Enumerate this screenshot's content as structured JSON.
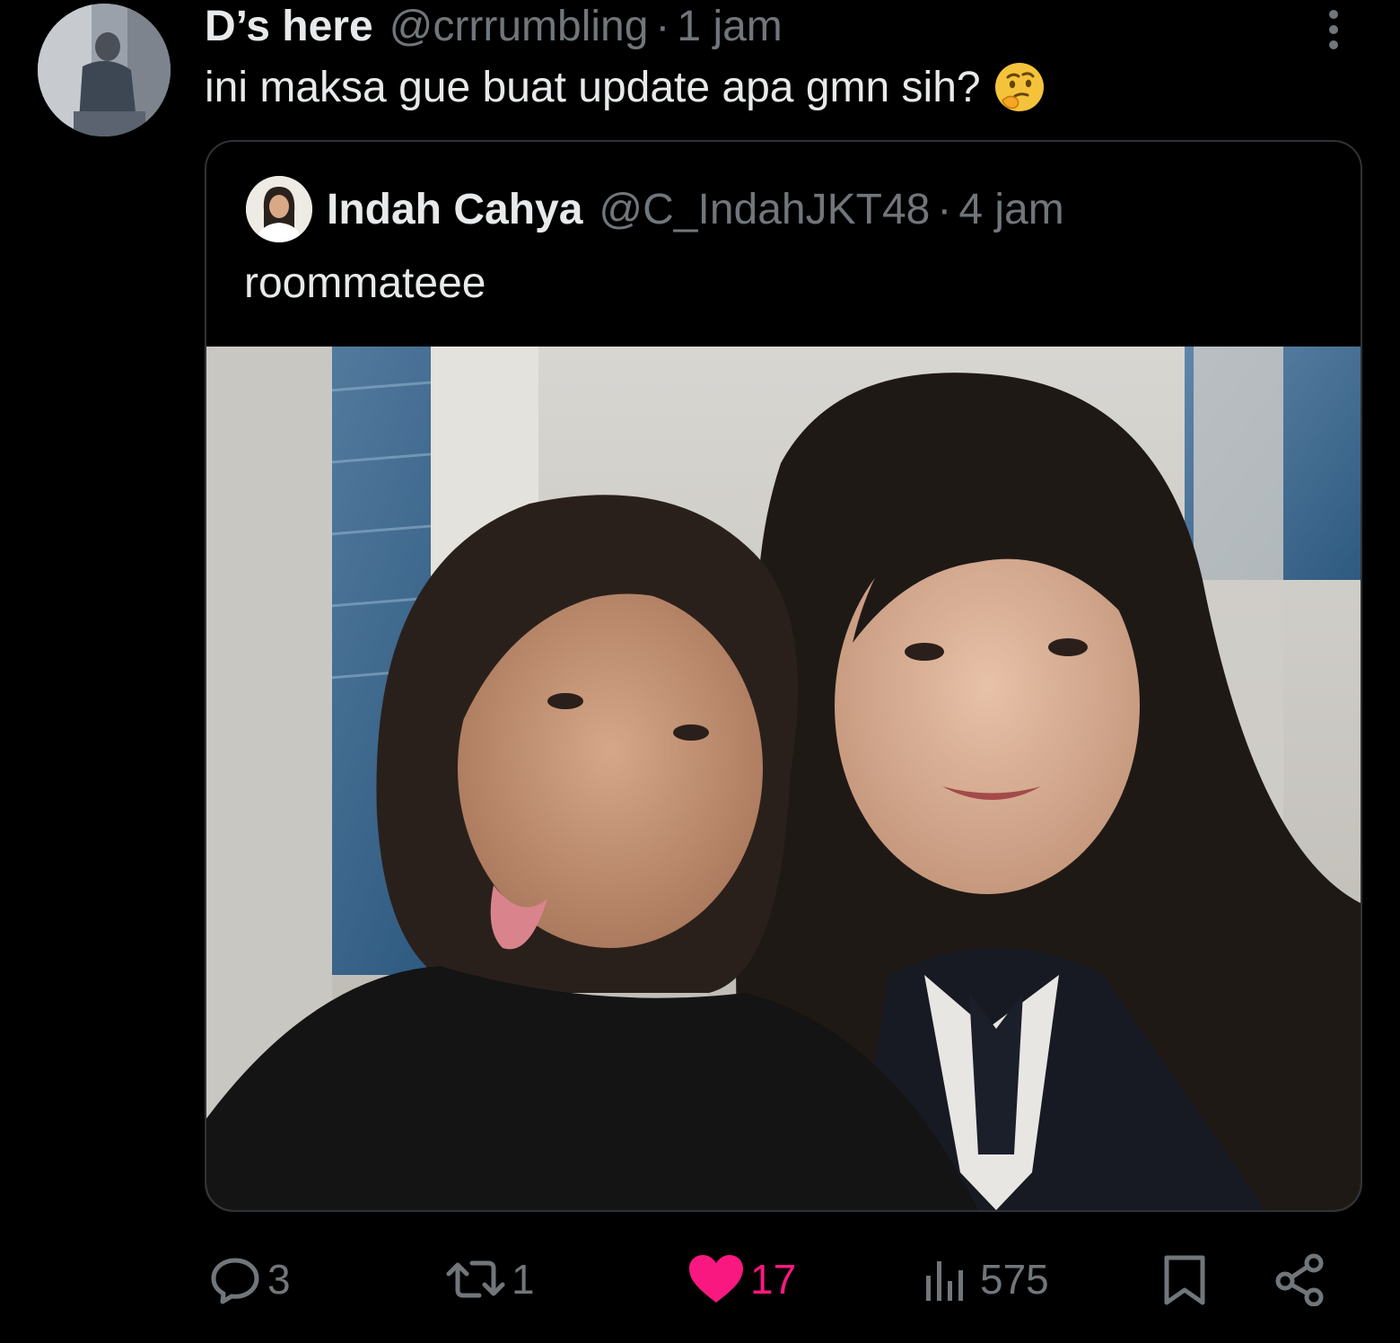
{
  "tweet": {
    "display_name": "D’s here",
    "handle": "@crrrumbling",
    "separator": "·",
    "time": "1 jam",
    "text": "ini maksa gue buat update apa gmn sih?",
    "emoji": "thinking-face-emoji"
  },
  "quoted_tweet": {
    "display_name": "Indah Cahya",
    "handle": "@C_IndahJKT48",
    "separator": "·",
    "time": "4 jam",
    "text": "roommateee",
    "media": "selfie-photo"
  },
  "actions": {
    "replies": "3",
    "reposts": "1",
    "likes": "17",
    "views": "575",
    "liked": true
  },
  "colors": {
    "background": "#000000",
    "text_primary": "#e7e9ea",
    "text_secondary": "#71767b",
    "border": "#2f3336",
    "like": "#f91880"
  },
  "icons": [
    "more-icon",
    "reply-icon",
    "repost-icon",
    "heart-icon",
    "views-icon",
    "bookmark-icon",
    "share-icon"
  ]
}
